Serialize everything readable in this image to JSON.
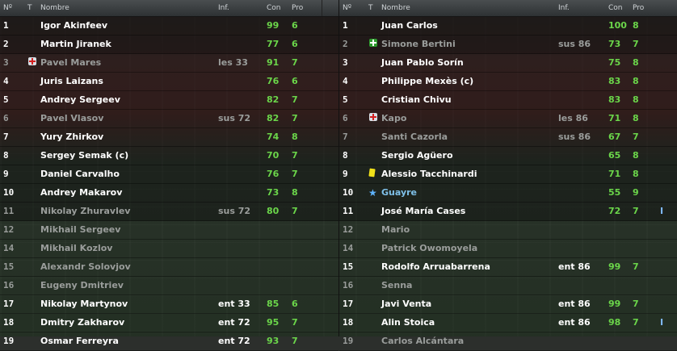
{
  "headers": {
    "num": "Nº",
    "t": "T",
    "name": "Nombre",
    "inf": "Inf.",
    "con": "Con",
    "pro": "Pro"
  },
  "left": [
    {
      "num": "1",
      "name": "Igor Akinfeev",
      "inf": "",
      "con": "99",
      "pro": "6",
      "icon": "",
      "dim": false,
      "bg": "dark"
    },
    {
      "num": "2",
      "name": "Martin Jiranek",
      "inf": "",
      "con": "77",
      "pro": "6",
      "icon": "",
      "dim": false,
      "bg": "dark"
    },
    {
      "num": "3",
      "name": "Pavel Mares",
      "inf": "les 33",
      "con": "91",
      "pro": "7",
      "icon": "injury",
      "dim": true,
      "bg": "mid"
    },
    {
      "num": "4",
      "name": "Juris Laizans",
      "inf": "",
      "con": "76",
      "pro": "6",
      "icon": "",
      "dim": false,
      "bg": "mid"
    },
    {
      "num": "5",
      "name": "Andrey Sergeev",
      "inf": "",
      "con": "82",
      "pro": "7",
      "icon": "",
      "dim": false,
      "bg": "mid"
    },
    {
      "num": "6",
      "name": "Pavel Vlasov",
      "inf": "sus 72",
      "con": "82",
      "pro": "7",
      "icon": "",
      "dim": true,
      "bg": "mid"
    },
    {
      "num": "7",
      "name": "Yury Zhirkov",
      "inf": "",
      "con": "74",
      "pro": "8",
      "icon": "",
      "dim": false,
      "bg": "mid"
    },
    {
      "num": "8",
      "name": "Sergey Semak (c)",
      "inf": "",
      "con": "70",
      "pro": "7",
      "icon": "",
      "dim": false,
      "bg": "mid"
    },
    {
      "num": "9",
      "name": "Daniel Carvalho",
      "inf": "",
      "con": "76",
      "pro": "7",
      "icon": "",
      "dim": false,
      "bg": "mid"
    },
    {
      "num": "10",
      "name": "Andrey Makarov",
      "inf": "",
      "con": "73",
      "pro": "8",
      "icon": "",
      "dim": false,
      "bg": "mid"
    },
    {
      "num": "11",
      "name": "Nikolay Zhuravlev",
      "inf": "sus 72",
      "con": "80",
      "pro": "7",
      "icon": "",
      "dim": true,
      "bg": "mid"
    },
    {
      "num": "12",
      "name": "Mikhail Sergeev",
      "inf": "",
      "con": "",
      "pro": "",
      "icon": "",
      "dim": true,
      "bg": ""
    },
    {
      "num": "14",
      "name": "Mikhail Kozlov",
      "inf": "",
      "con": "",
      "pro": "",
      "icon": "",
      "dim": true,
      "bg": ""
    },
    {
      "num": "15",
      "name": "Alexandr Solovjov",
      "inf": "",
      "con": "",
      "pro": "",
      "icon": "",
      "dim": true,
      "bg": ""
    },
    {
      "num": "16",
      "name": "Eugeny Dmitriev",
      "inf": "",
      "con": "",
      "pro": "",
      "icon": "",
      "dim": true,
      "bg": ""
    },
    {
      "num": "17",
      "name": "Nikolay Martynov",
      "inf": "ent 33",
      "con": "85",
      "pro": "6",
      "icon": "",
      "dim": false,
      "bg": ""
    },
    {
      "num": "18",
      "name": "Dmitry Zakharov",
      "inf": "ent 72",
      "con": "95",
      "pro": "7",
      "icon": "",
      "dim": false,
      "bg": ""
    },
    {
      "num": "19",
      "name": "Osmar Ferreyra",
      "inf": "ent 72",
      "con": "93",
      "pro": "7",
      "icon": "",
      "dim": false,
      "bg": ""
    }
  ],
  "right": [
    {
      "num": "1",
      "name": "Juan Carlos",
      "inf": "",
      "con": "100",
      "pro": "8",
      "icon": "",
      "extra": "",
      "dim": false,
      "hl": false,
      "bg": "dark"
    },
    {
      "num": "2",
      "name": "Simone Bertini",
      "inf": "sus 86",
      "con": "73",
      "pro": "7",
      "icon": "green-plus",
      "extra": "",
      "dim": true,
      "hl": false,
      "bg": "dark"
    },
    {
      "num": "3",
      "name": "Juan Pablo Sorín",
      "inf": "",
      "con": "75",
      "pro": "8",
      "icon": "",
      "extra": "",
      "dim": false,
      "hl": false,
      "bg": "mid"
    },
    {
      "num": "4",
      "name": "Philippe Mexès (c)",
      "inf": "",
      "con": "83",
      "pro": "8",
      "icon": "",
      "extra": "",
      "dim": false,
      "hl": false,
      "bg": "mid"
    },
    {
      "num": "5",
      "name": "Cristian Chivu",
      "inf": "",
      "con": "83",
      "pro": "8",
      "icon": "",
      "extra": "",
      "dim": false,
      "hl": false,
      "bg": "mid"
    },
    {
      "num": "6",
      "name": "Kapo",
      "inf": "les 86",
      "con": "71",
      "pro": "8",
      "icon": "injury",
      "extra": "",
      "dim": true,
      "hl": false,
      "bg": "mid"
    },
    {
      "num": "7",
      "name": "Santi Cazorla",
      "inf": "sus 86",
      "con": "67",
      "pro": "7",
      "icon": "",
      "extra": "",
      "dim": true,
      "hl": false,
      "bg": "mid"
    },
    {
      "num": "8",
      "name": "Sergio Agüero",
      "inf": "",
      "con": "65",
      "pro": "8",
      "icon": "",
      "extra": "",
      "dim": false,
      "hl": false,
      "bg": "mid"
    },
    {
      "num": "9",
      "name": "Alessio Tacchinardi",
      "inf": "",
      "con": "71",
      "pro": "8",
      "icon": "yellow-card",
      "extra": "",
      "dim": false,
      "hl": false,
      "bg": "mid"
    },
    {
      "num": "10",
      "name": "Guayre",
      "inf": "",
      "con": "55",
      "pro": "9",
      "icon": "star",
      "extra": "",
      "dim": false,
      "hl": true,
      "bg": "mid"
    },
    {
      "num": "11",
      "name": "José María Cases",
      "inf": "",
      "con": "72",
      "pro": "7",
      "icon": "",
      "extra": "I",
      "dim": false,
      "hl": false,
      "bg": "mid"
    },
    {
      "num": "12",
      "name": "Mario",
      "inf": "",
      "con": "",
      "pro": "",
      "icon": "",
      "extra": "",
      "dim": true,
      "hl": false,
      "bg": ""
    },
    {
      "num": "14",
      "name": "Patrick Owomoyela",
      "inf": "",
      "con": "",
      "pro": "",
      "icon": "",
      "extra": "",
      "dim": true,
      "hl": false,
      "bg": ""
    },
    {
      "num": "15",
      "name": "Rodolfo Arruabarrena",
      "inf": "ent 86",
      "con": "99",
      "pro": "7",
      "icon": "",
      "extra": "",
      "dim": false,
      "hl": false,
      "bg": ""
    },
    {
      "num": "16",
      "name": "Senna",
      "inf": "",
      "con": "",
      "pro": "",
      "icon": "",
      "extra": "",
      "dim": true,
      "hl": false,
      "bg": ""
    },
    {
      "num": "17",
      "name": "Javi Venta",
      "inf": "ent 86",
      "con": "99",
      "pro": "7",
      "icon": "",
      "extra": "",
      "dim": false,
      "hl": false,
      "bg": ""
    },
    {
      "num": "18",
      "name": "Alin Stoica",
      "inf": "ent 86",
      "con": "98",
      "pro": "7",
      "icon": "",
      "extra": "I",
      "dim": false,
      "hl": false,
      "bg": ""
    },
    {
      "num": "19",
      "name": "Carlos Alcántara",
      "inf": "",
      "con": "",
      "pro": "",
      "icon": "",
      "extra": "",
      "dim": true,
      "hl": false,
      "bg": ""
    }
  ]
}
